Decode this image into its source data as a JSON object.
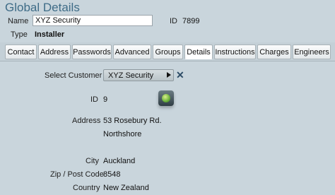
{
  "header": {
    "title": "Global Details"
  },
  "form": {
    "name_label": "Name",
    "name_value": "XYZ Security",
    "id_label": "ID",
    "id_value": "7899",
    "type_label": "Type",
    "type_value": "Installer"
  },
  "tabs": [
    {
      "label": "Contact"
    },
    {
      "label": "Address"
    },
    {
      "label": "Passwords"
    },
    {
      "label": "Advanced"
    },
    {
      "label": "Groups"
    },
    {
      "label": "Details",
      "active": true
    },
    {
      "label": "Instructions"
    },
    {
      "label": "Charges"
    },
    {
      "label": "Engineers"
    }
  ],
  "details": {
    "select_customer_label": "Select Customer",
    "select_customer_value": "XYZ Security",
    "id_label": "ID",
    "id_value": "9",
    "address_label": "Address",
    "address_line1": "53 Rosebury Rd.",
    "address_line2": "Northshore",
    "city_label": "City",
    "city_value": "Auckland",
    "zip_label": "Zip / Post Code",
    "zip_value": "8548",
    "country_label": "Country",
    "country_value": "New Zealand"
  },
  "icons": {
    "globe": "globe-icon",
    "clear": "close-icon",
    "dropdown": "triangle-right-icon"
  }
}
